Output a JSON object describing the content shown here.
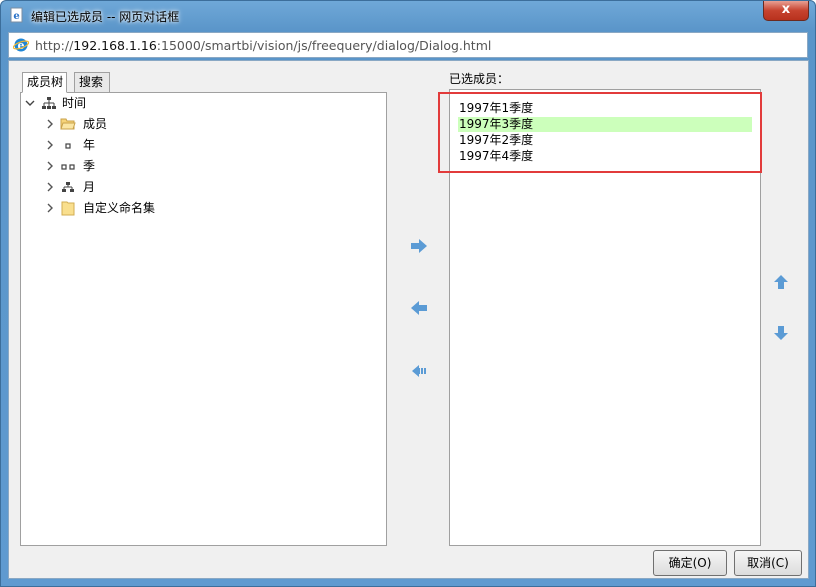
{
  "window": {
    "title": "编辑已选成员 -- 网页对话框",
    "close_label": "x"
  },
  "address": {
    "prefix": "http://",
    "host": "192.168.1.16",
    "rest": ":15000/smartbi/vision/js/freequery/dialog/Dialog.html"
  },
  "tabs": [
    {
      "label": "成员树",
      "active": true
    },
    {
      "label": "搜索",
      "active": false
    }
  ],
  "tree": {
    "root": {
      "label": "时间",
      "icon": "hierarchy-icon",
      "expanded": true
    },
    "children": [
      {
        "label": "成员",
        "icon": "open-folder-icon"
      },
      {
        "label": "年",
        "icon": "level-one-icon"
      },
      {
        "label": "季",
        "icon": "level-two-icon"
      },
      {
        "label": "月",
        "icon": "hierarchy-icon"
      },
      {
        "label": "自定义命名集",
        "icon": "folder-icon"
      }
    ]
  },
  "selected_panel": {
    "label": "已选成员：",
    "members": [
      {
        "text": "1997年1季度",
        "selected": false
      },
      {
        "text": "1997年3季度",
        "selected": true
      },
      {
        "text": "1997年2季度",
        "selected": false
      },
      {
        "text": "1997年4季度",
        "selected": false
      }
    ]
  },
  "buttons": {
    "ok": "确定(O)",
    "cancel": "取消(C)"
  },
  "colors": {
    "accent_arrow": "#5b9bd5",
    "selected_row": "#ccffbb",
    "highlight_border": "#e23b3b"
  }
}
